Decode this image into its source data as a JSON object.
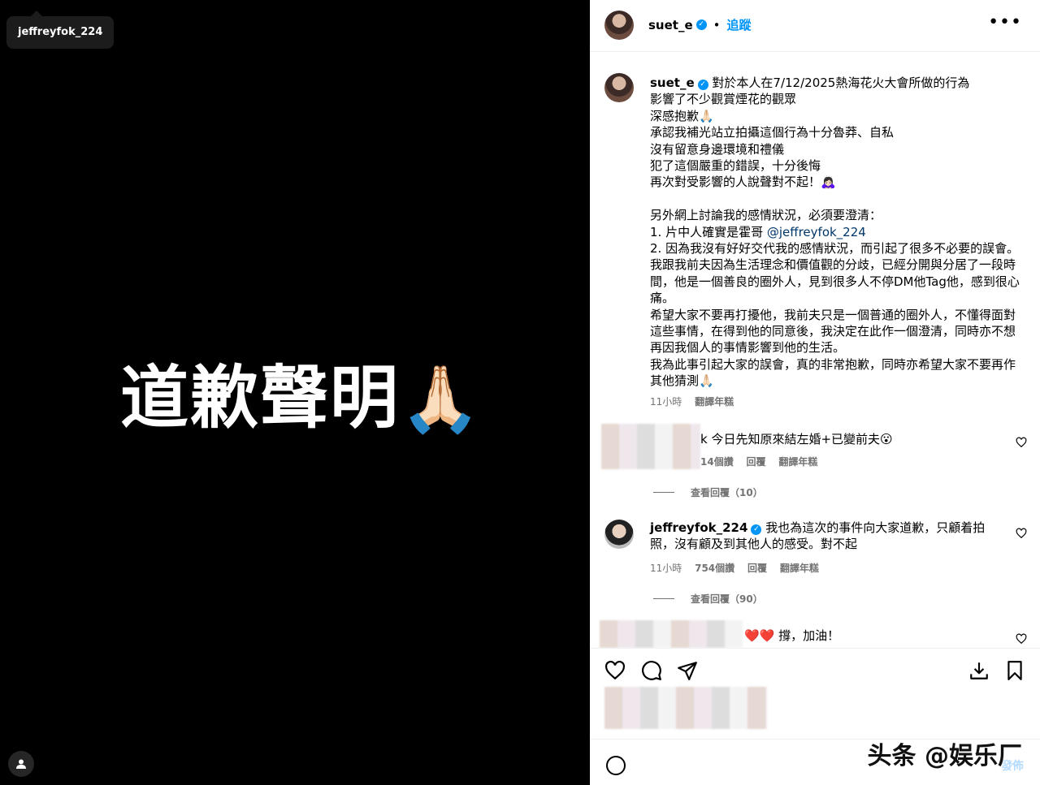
{
  "media": {
    "tag_username": "jeffreyfok_224",
    "title": "道歉聲明",
    "emoji": "🙏🏻"
  },
  "header": {
    "username": "suet_e",
    "separator": "•",
    "follow_label": "追蹤",
    "more_label": "•••"
  },
  "caption": {
    "username": "suet_e",
    "lines": [
      "對於本人在7/12/2025熱海花火大會所做的行為",
      "影響了不少觀賞煙花的觀眾",
      "深感抱歉🙏🏻",
      "承認我補光站立拍攝這個行為十分魯莽、自私",
      "沒有留意身邊環境和禮儀",
      "犯了這個嚴重的錯誤，十分後悔",
      "再次對受影響的人說聲對不起！🙇🏻‍♀️",
      "",
      "另外網上討論我的感情狀況，必須要澄清：",
      "1. 片中人確實是霍哥 ",
      "2. 因為我沒有好好交代我的感情狀況，而引起了很多不必要的誤會。我跟我前夫因為生活理念和價值觀的分歧，已經分開與分居了一段時間，他是一個善良的圈外人，見到很多人不停DM他Tag他，感到很心痛。",
      "希望大家不要再打擾他，我前夫只是一個普通的圈外人，不懂得面對這些事情，在得到他的同意後，我決定在此作一個澄清，同時亦不想再因我個人的事情影響到他的生活。",
      "我為此事引起大家的誤會，真的非常抱歉，同時亦希望大家不要再作其他猜測🙏🏻"
    ],
    "mention": "@jeffreyfok_224",
    "time": "11小時",
    "translate": "翻譯年糕"
  },
  "comments": [
    {
      "text": "k 今日先知原來結左婚+已變前夫😮",
      "likes": "14個讚",
      "reply": "回覆",
      "translate": "翻譯年糕",
      "view_replies": "查看回覆（10）"
    },
    {
      "username": "jeffreyfok_224",
      "text": "我也為這次的事件向大家道歉，只顧着拍照，沒有顧及到其他人的感受。對不起",
      "time": "11小時",
      "likes": "754個讚",
      "reply": "回覆",
      "translate": "翻譯年糕",
      "view_replies": "查看回覆（90）"
    },
    {
      "text": "❤️❤️ 撐，加油！"
    }
  ],
  "footer": {
    "post_label": "發佈",
    "watermark": "头条 @娱乐厂"
  }
}
